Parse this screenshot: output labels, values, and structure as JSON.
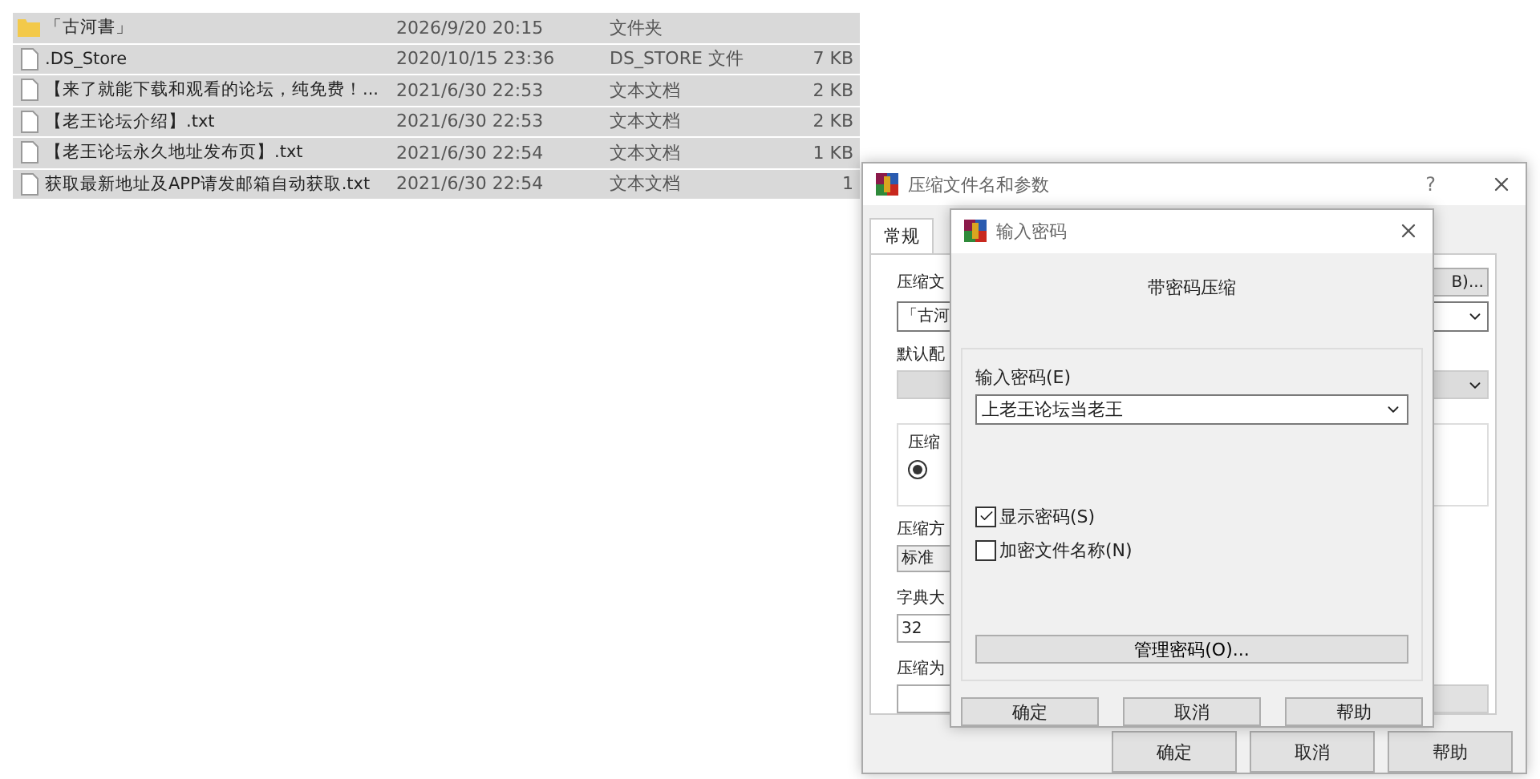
{
  "files": [
    {
      "kind": "folder",
      "name": "「古河書」",
      "date": "2026/9/20 20:15",
      "type": "文件夹"
    },
    {
      "kind": "file",
      "name": ".DS_Store",
      "date": "2020/10/15 23:36",
      "type": "DS_STORE 文件",
      "size": "7 KB"
    },
    {
      "kind": "file",
      "name": "【来了就能下载和观看的论坛，纯免费！...",
      "date": "2021/6/30 22:53",
      "type": "文本文档",
      "size": "2 KB"
    },
    {
      "kind": "file",
      "name": "【老王论坛介绍】.txt",
      "date": "2021/6/30 22:53",
      "type": "文本文档",
      "size": "2 KB"
    },
    {
      "kind": "file",
      "name": "【老王论坛永久地址发布页】.txt",
      "date": "2021/6/30 22:54",
      "type": "文本文档",
      "size": "1 KB"
    },
    {
      "kind": "file",
      "name": "获取最新地址及APP请发邮箱自动获取.txt",
      "date": "2021/6/30 22:54",
      "type": "文本文档",
      "size": "1"
    }
  ],
  "archive_dialog": {
    "title": "压缩文件名和参数",
    "help": "?",
    "tab": {
      "label": "常规",
      "selected": true
    },
    "archive_name_label": "压缩文",
    "browse_button": "B)...",
    "archive_name": "「古河",
    "profile_label": "默认配",
    "group_label": "压缩",
    "radio_selected": true,
    "method_label": "压缩方",
    "method": "标准",
    "dict_label": "字典大",
    "dict": "32",
    "split_label": "压缩为",
    "buttons": [
      "确定",
      "取消",
      "帮助"
    ]
  },
  "password_dialog": {
    "title": "输入密码",
    "heading": "带密码压缩",
    "password_label": "输入密码(E)",
    "password": "上老王论坛当老王",
    "checkboxes": [
      {
        "label": "显示密码(S)",
        "checked": true
      },
      {
        "label": "加密文件名称(N)",
        "checked": false
      }
    ],
    "manage_button": "管理密码(O)...",
    "buttons": [
      "确定",
      "取消",
      "帮助"
    ]
  }
}
